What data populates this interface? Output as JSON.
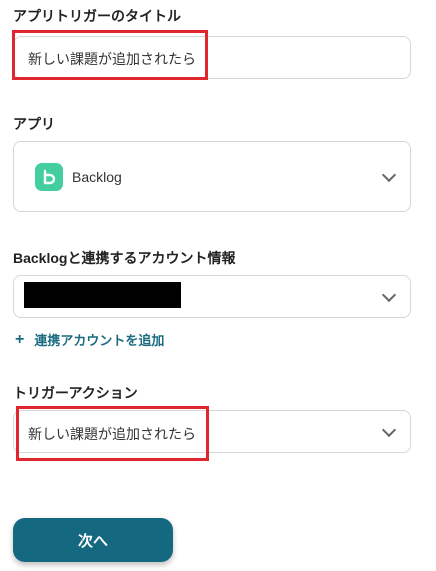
{
  "trigger_title": {
    "label": "アプリトリガーのタイトル",
    "value": "新しい課題が追加されたら"
  },
  "app": {
    "label": "アプリ",
    "selected": "Backlog",
    "icon_color": "#42ce9f"
  },
  "account": {
    "label": "Backlogと連携するアカウント情報",
    "add_link": "連携アカウントを追加"
  },
  "trigger_action": {
    "label": "トリガーアクション",
    "selected": "新しい課題が追加されたら"
  },
  "next_button": {
    "label": "次へ"
  },
  "colors": {
    "primary": "#14687f",
    "link": "#1b6b80",
    "highlight": "#e0262e"
  }
}
